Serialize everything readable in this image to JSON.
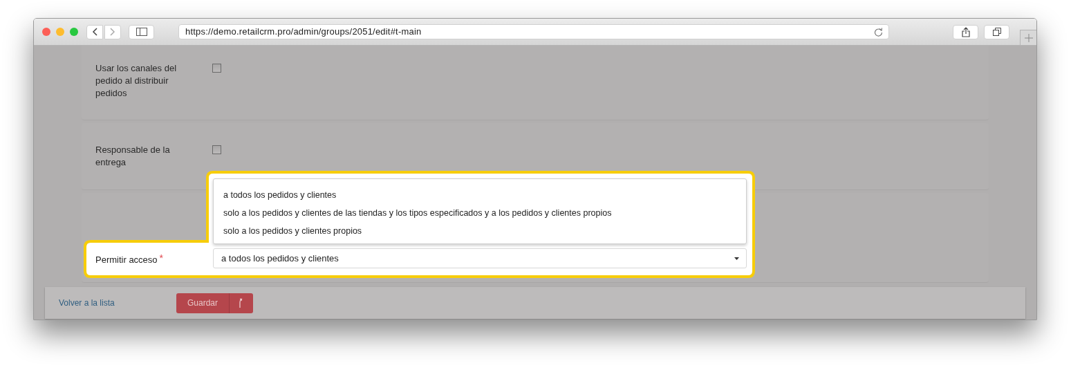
{
  "browser": {
    "url": "https://demo.retailcrm.pro/admin/groups/2051/edit#t-main"
  },
  "form": {
    "rows": [
      {
        "kind": "checkbox",
        "label": "Usar los canales del pedido al distribuir pedidos",
        "checked": false
      },
      {
        "kind": "checkbox",
        "label": "Responsable de la entrega",
        "checked": false
      }
    ],
    "access": {
      "label": "Permitir acceso",
      "required_mark": "*",
      "value": "a todos los pedidos y clientes",
      "expanded": true,
      "options": [
        "a todos los pedidos y clientes",
        "solo a los pedidos y clientes de las tiendas y los tipos especificados y a los pedidos y clientes propios",
        "solo a los pedidos y clientes propios"
      ]
    }
  },
  "footer": {
    "back_link": "Volver a la lista",
    "save_button": "Guardar"
  }
}
